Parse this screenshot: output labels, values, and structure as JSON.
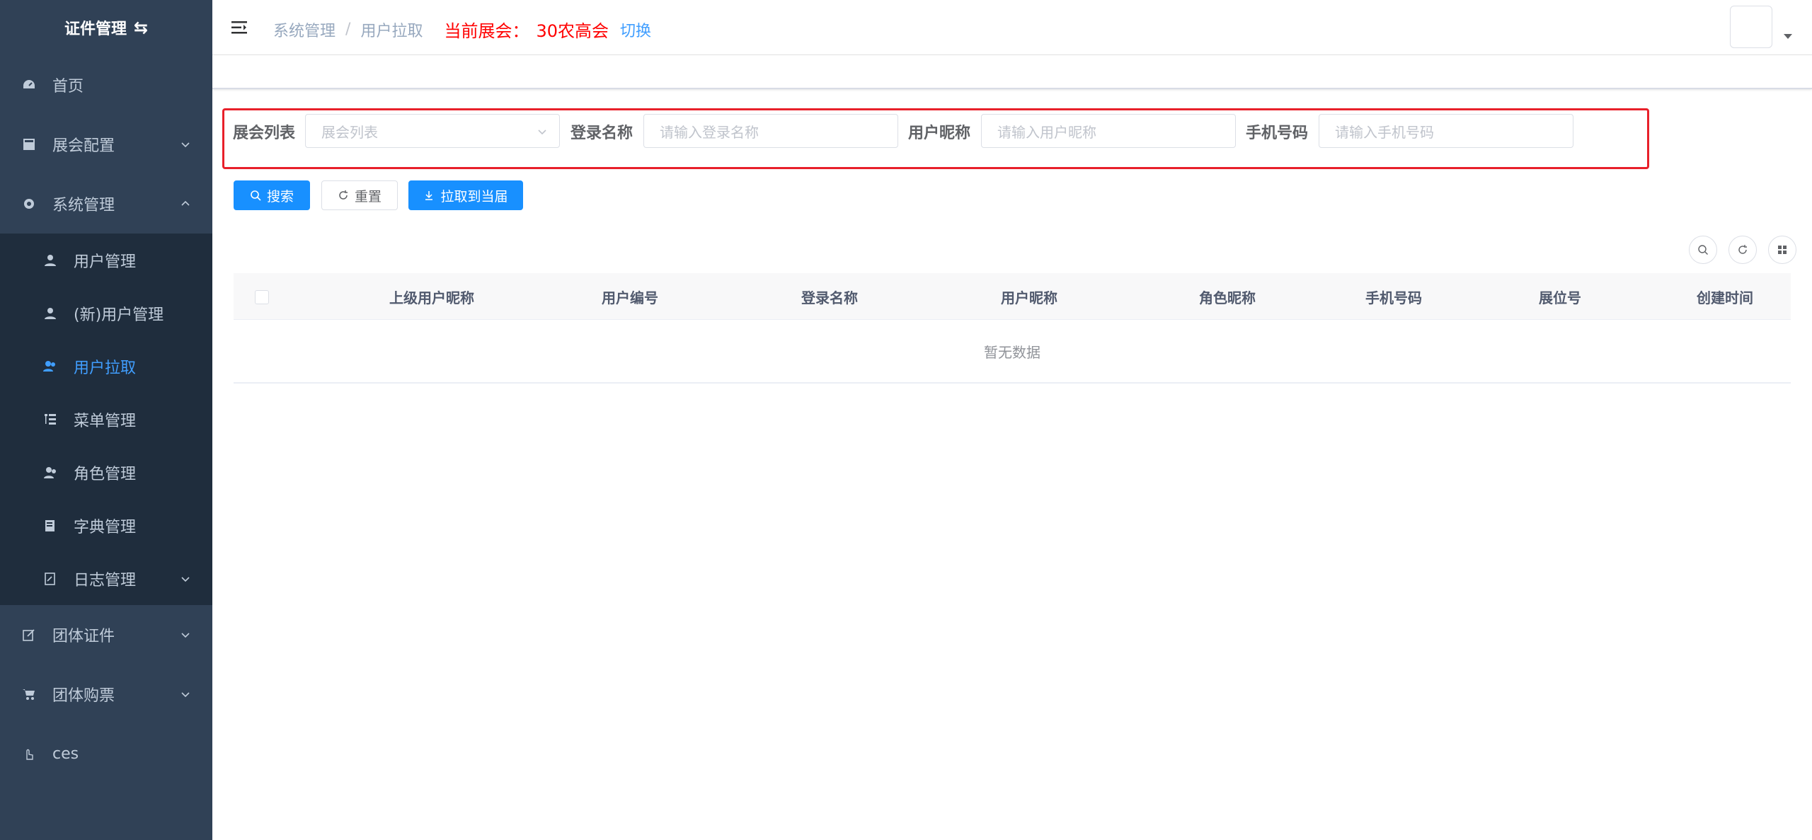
{
  "sidebar": {
    "title": "证件管理",
    "items": [
      {
        "label": "首页",
        "icon": "dashboard-icon"
      },
      {
        "label": "展会配置",
        "icon": "exhibition-icon"
      },
      {
        "label": "系统管理",
        "icon": "gear-icon"
      },
      {
        "label": "团体证件",
        "icon": "edit-icon"
      },
      {
        "label": "团体购票",
        "icon": "cart-icon"
      },
      {
        "label": "ces",
        "icon": "hand-icon"
      }
    ],
    "submenu": [
      {
        "label": "用户管理",
        "icon": "user-icon"
      },
      {
        "label": "(新)用户管理",
        "icon": "user-icon"
      },
      {
        "label": "用户拉取",
        "icon": "users-icon",
        "active": true
      },
      {
        "label": "菜单管理",
        "icon": "tree-table-icon"
      },
      {
        "label": "角色管理",
        "icon": "peoples-icon"
      },
      {
        "label": "字典管理",
        "icon": "dict-icon"
      },
      {
        "label": "日志管理",
        "icon": "log-icon"
      }
    ]
  },
  "header": {
    "breadcrumb": [
      "系统管理",
      "用户拉取"
    ],
    "current_label": "当前展会：",
    "current_value": "30农高会",
    "switch_label": "切换"
  },
  "filters": {
    "exhibition": {
      "label": "展会列表",
      "placeholder": "展会列表"
    },
    "login_name": {
      "label": "登录名称",
      "placeholder": "请输入登录名称"
    },
    "nickname": {
      "label": "用户昵称",
      "placeholder": "请输入用户昵称"
    },
    "phone": {
      "label": "手机号码",
      "placeholder": "请输入手机号码"
    }
  },
  "buttons": {
    "search": "搜索",
    "reset": "重置",
    "pull": "拉取到当届"
  },
  "table": {
    "columns": [
      "上级用户昵称",
      "用户编号",
      "登录名称",
      "用户昵称",
      "角色昵称",
      "手机号码",
      "展位号",
      "创建时间"
    ],
    "empty_text": "暂无数据"
  },
  "colors": {
    "sidebar_bg": "#304156",
    "submenu_bg": "#1f2d3d",
    "active": "#409eff",
    "primary": "#1890ff",
    "highlight_border": "#e8202a",
    "current_exhibition": "#ff0000"
  }
}
